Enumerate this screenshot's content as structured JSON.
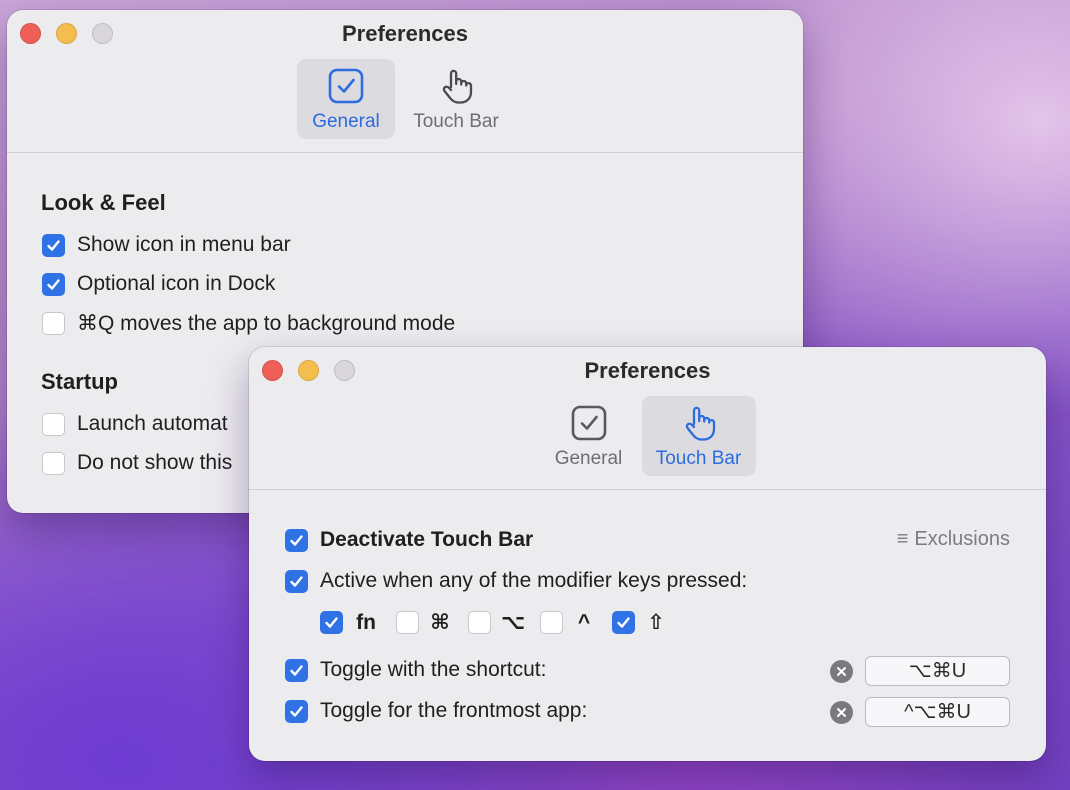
{
  "window_general": {
    "title": "Preferences",
    "tabs": [
      {
        "label": "General",
        "icon": "checkbox-icon",
        "selected": true
      },
      {
        "label": "Touch Bar",
        "icon": "hand-pointer-icon",
        "selected": false
      }
    ],
    "look_feel": {
      "heading": "Look & Feel",
      "options": [
        {
          "label": "Show icon in menu bar",
          "checked": true
        },
        {
          "label": "Optional icon in Dock",
          "checked": true
        },
        {
          "label": "⌘Q moves the app to background mode",
          "checked": false
        }
      ]
    },
    "startup": {
      "heading": "Startup",
      "options": [
        {
          "label": "Launch automat",
          "checked": false
        },
        {
          "label": "Do not show this",
          "checked": false
        }
      ]
    }
  },
  "window_touchbar": {
    "title": "Preferences",
    "tabs": [
      {
        "label": "General",
        "icon": "checkbox-icon",
        "selected": false
      },
      {
        "label": "Touch Bar",
        "icon": "hand-pointer-icon",
        "selected": true
      }
    ],
    "deactivate": {
      "label": "Deactivate Touch Bar",
      "checked": true
    },
    "exclusions_label": "Exclusions",
    "modifier": {
      "label": "Active when any of the modifier keys pressed:",
      "checked": true
    },
    "modifier_keys": [
      {
        "key": "fn",
        "checked": true
      },
      {
        "key": "⌘",
        "checked": false
      },
      {
        "key": "⌥",
        "checked": false
      },
      {
        "key": "^",
        "checked": false
      },
      {
        "key": "⇧",
        "checked": true
      }
    ],
    "toggle_shortcut": {
      "label": "Toggle with the shortcut:",
      "checked": true,
      "shortcut": "⌥⌘U"
    },
    "toggle_frontmost": {
      "label": "Toggle for the frontmost app:",
      "checked": true,
      "shortcut": "^⌥⌘U"
    }
  },
  "colors": {
    "accent": "#2F72E6",
    "window_bg": "#ECEBEE",
    "close": "#EE5F57",
    "minimize": "#F4BE4F"
  }
}
